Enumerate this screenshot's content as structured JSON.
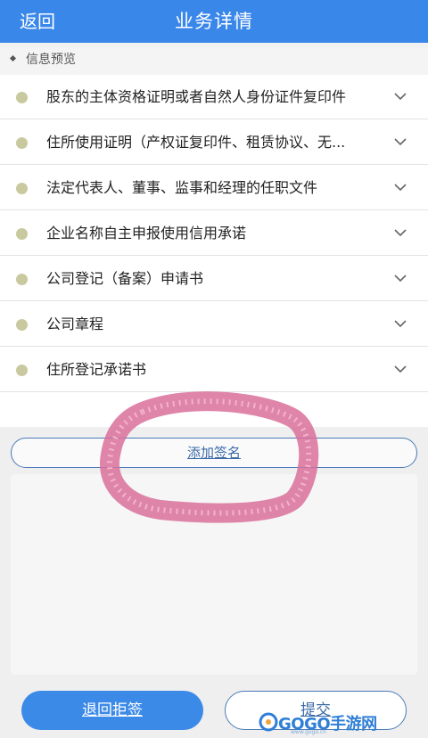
{
  "header": {
    "back_label": "返回",
    "title": "业务详情"
  },
  "section": {
    "label": "信息预览"
  },
  "documents": [
    {
      "label": "股东的主体资格证明或者自然人身份证件复印件"
    },
    {
      "label": "住所使用证明（产权证复印件、租赁协议、无..."
    },
    {
      "label": "法定代表人、董事、监事和经理的任职文件"
    },
    {
      "label": "企业名称自主申报使用信用承诺"
    },
    {
      "label": "公司登记（备案）申请书"
    },
    {
      "label": "公司章程"
    },
    {
      "label": "住所登记承诺书"
    }
  ],
  "signature": {
    "add_label": "添加签名"
  },
  "footer": {
    "reject_label": "退回拒签",
    "submit_label": "提交"
  },
  "watermark": {
    "text": "GOGO手游网",
    "sub": "www.gogo.cn"
  },
  "colors": {
    "primary": "#3a87ea",
    "dot": "#c9c9a0",
    "annotation": "#d9709a"
  }
}
